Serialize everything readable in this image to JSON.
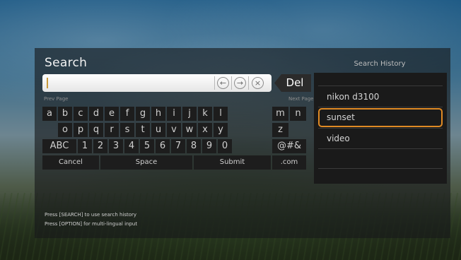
{
  "search": {
    "title": "Search",
    "value": "",
    "prev_page": "Prev Page",
    "next_page": "Next Page",
    "controls": [
      {
        "icon": "arrow-left-icon",
        "glyph": "←"
      },
      {
        "icon": "arrow-right-icon",
        "glyph": "→"
      },
      {
        "icon": "clear-icon",
        "glyph": "×"
      }
    ],
    "del_label": "Del"
  },
  "keyboard": {
    "row1": [
      "a",
      "b",
      "c",
      "d",
      "e",
      "f",
      "g",
      "h",
      "i",
      "j",
      "k",
      "l",
      "m",
      "n"
    ],
    "row2": [
      "o",
      "p",
      "q",
      "r",
      "s",
      "t",
      "u",
      "v",
      "w",
      "x",
      "y",
      "z"
    ],
    "row3_mode": "ABC",
    "row3_digits": [
      "1",
      "2",
      "3",
      "4",
      "5",
      "6",
      "7",
      "8",
      "9",
      "0"
    ],
    "row3_symbols": "@#&",
    "cancel": "Cancel",
    "space": "Space",
    "submit": "Submit",
    "dotcom": ".com"
  },
  "history": {
    "title": "Search History",
    "items": [
      "nikon d3100",
      "sunset",
      "video"
    ],
    "selected_index": 1,
    "accent": "#e08a24"
  },
  "help": {
    "line1": "Press [SEARCH] to use search history",
    "line2": "Press [OPTION] for multi-lingual input"
  }
}
